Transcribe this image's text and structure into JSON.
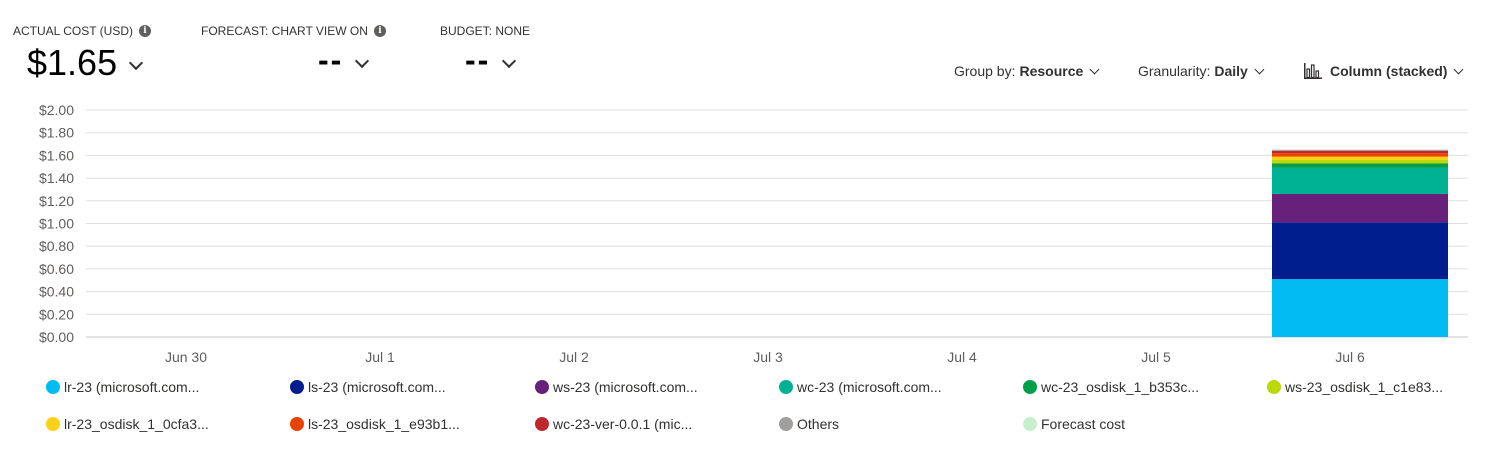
{
  "kpis": {
    "actual_cost": {
      "label": "ACTUAL COST (USD)",
      "value": "$1.65"
    },
    "forecast": {
      "label": "FORECAST: CHART VIEW ON",
      "value": "--"
    },
    "budget": {
      "label": "BUDGET: NONE",
      "value": "--"
    }
  },
  "controls": {
    "group_by": {
      "label": "Group by:",
      "value": "Resource"
    },
    "granularity": {
      "label": "Granularity:",
      "value": "Daily"
    },
    "chart_type": {
      "value": "Column (stacked)"
    }
  },
  "chart_data": {
    "type": "bar",
    "stacked": true,
    "categories": [
      "Jun 30",
      "Jul 1",
      "Jul 2",
      "Jul 3",
      "Jul 4",
      "Jul 5",
      "Jul 6"
    ],
    "ylim": [
      0,
      2.0
    ],
    "yticks": [
      0,
      0.2,
      0.4,
      0.6,
      0.8,
      1.0,
      1.2,
      1.4,
      1.6,
      1.8,
      2.0
    ],
    "ytick_labels": [
      "$0.00",
      "$0.20",
      "$0.40",
      "$0.60",
      "$0.80",
      "$1.00",
      "$1.20",
      "$1.40",
      "$1.60",
      "$1.80",
      "$2.00"
    ],
    "grid": true,
    "legend_position": "bottom",
    "series": [
      {
        "name": "lr-23 (microsoft.com...",
        "color": "#00bcf2",
        "values": [
          0,
          0,
          0,
          0,
          0,
          0,
          0.51
        ]
      },
      {
        "name": "ls-23 (microsoft.com...",
        "color": "#001d8d",
        "values": [
          0,
          0,
          0,
          0,
          0,
          0,
          0.5
        ]
      },
      {
        "name": "ws-23 (microsoft.com...",
        "color": "#68217a",
        "values": [
          0,
          0,
          0,
          0,
          0,
          0,
          0.25
        ]
      },
      {
        "name": "wc-23 (microsoft.com...",
        "color": "#00b294",
        "values": [
          0,
          0,
          0,
          0,
          0,
          0,
          0.23
        ]
      },
      {
        "name": "wc-23_osdisk_1_b353c...",
        "color": "#009e49",
        "values": [
          0,
          0,
          0,
          0,
          0,
          0,
          0.04
        ]
      },
      {
        "name": "ws-23_osdisk_1_c1e83...",
        "color": "#bad80a",
        "values": [
          0,
          0,
          0,
          0,
          0,
          0,
          0.03
        ]
      },
      {
        "name": "lr-23_osdisk_1_0cfa3...",
        "color": "#fcd116",
        "values": [
          0,
          0,
          0,
          0,
          0,
          0,
          0.03
        ]
      },
      {
        "name": "ls-23_osdisk_1_e93b1...",
        "color": "#ea4300",
        "values": [
          0,
          0,
          0,
          0,
          0,
          0,
          0.03
        ]
      },
      {
        "name": "wc-23-ver-0.0.1 (mic...",
        "color": "#c0272d",
        "values": [
          0,
          0,
          0,
          0,
          0,
          0,
          0.02
        ]
      },
      {
        "name": "Others",
        "color": "#a19f9d",
        "values": [
          0,
          0,
          0,
          0,
          0,
          0,
          0.01
        ]
      },
      {
        "name": "Forecast cost",
        "color": "#c6efce",
        "values": [
          0,
          0,
          0,
          0,
          0,
          0,
          0
        ]
      }
    ]
  }
}
